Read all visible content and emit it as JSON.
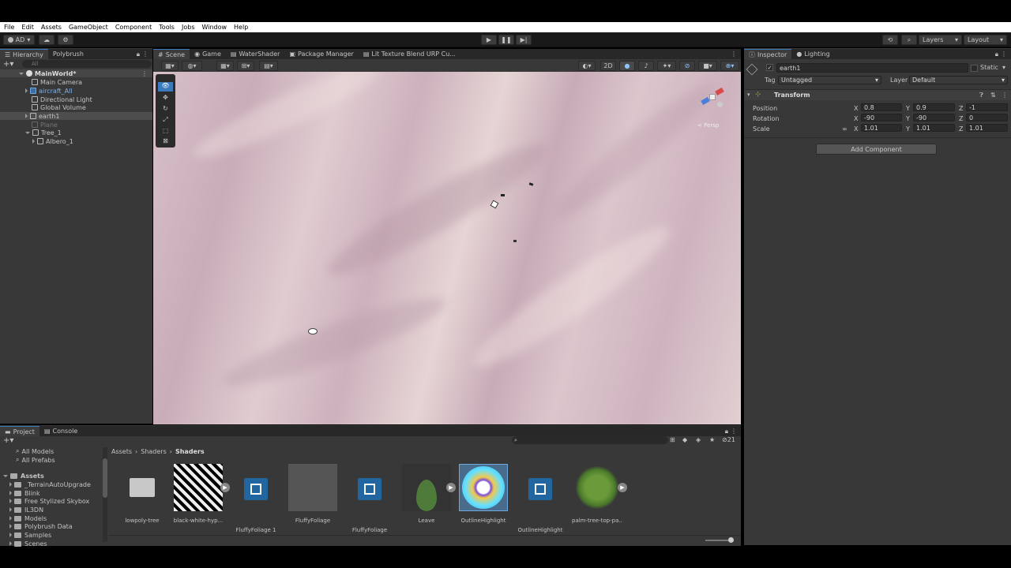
{
  "menu": [
    "File",
    "Edit",
    "Assets",
    "GameObject",
    "Component",
    "Tools",
    "Jobs",
    "Window",
    "Help"
  ],
  "toolbar": {
    "account": "AD",
    "layers": "Layers",
    "layout": "Layout"
  },
  "hierarchy": {
    "tabs": [
      "Hierarchy",
      "Polybrush"
    ],
    "search_placeholder": "All",
    "items": [
      {
        "label": "MainWorld*"
      },
      {
        "label": "Main Camera"
      },
      {
        "label": "aircraft_All"
      },
      {
        "label": "Directional Light"
      },
      {
        "label": "Global Volume"
      },
      {
        "label": "earth1"
      },
      {
        "label": "Plane"
      },
      {
        "label": "Tree_1"
      },
      {
        "label": "Albero_1"
      }
    ]
  },
  "scene_tabs": [
    "Scene",
    "Game",
    "WaterShader",
    "Package Manager",
    "Lit Texture Blend URP Cu..."
  ],
  "scene_toolbar": {
    "mode_2d": "2D"
  },
  "gizmo": {
    "persp": "< Persp"
  },
  "inspector": {
    "tabs": [
      "Inspector",
      "Lighting"
    ],
    "object_name": "earth1",
    "static_label": "Static",
    "tag_label": "Tag",
    "tag_value": "Untagged",
    "layer_label": "Layer",
    "layer_value": "Default",
    "component": "Transform",
    "position": {
      "label": "Position",
      "x": "0.8",
      "y": "0.9",
      "z": "-1"
    },
    "rotation": {
      "label": "Rotation",
      "x": "-90",
      "y": "-90",
      "z": "0"
    },
    "scale": {
      "label": "Scale",
      "x": "1.01",
      "y": "1.01",
      "z": "1.01"
    },
    "add_component": "Add Component"
  },
  "project": {
    "tabs": [
      "Project",
      "Console"
    ],
    "favorites": [
      "All Models",
      "All Prefabs"
    ],
    "assets_root": "Assets",
    "folders": [
      "_TerrainAutoUpgrade",
      "Blink",
      "Free Stylized Skybox",
      "IL3DN",
      "Models",
      "Polybrush Data",
      "Samples",
      "Scenes"
    ],
    "breadcrumb": [
      "Assets",
      "Shaders",
      "Shaders"
    ],
    "hidden_count": "21",
    "assets": [
      "lowpoly-tree",
      "black-white-hyp...",
      "FluffyFoliage 1",
      "FluffyFoliage",
      "FluffyFoliage",
      "Leave",
      "OutlineHighlight",
      "OutlineHighlight",
      "palm-tree-top-pa..."
    ]
  },
  "colors": {
    "accent": "#3a79bb",
    "scene_bg": "#d4bcc5",
    "panel": "#383838",
    "menubar": "#ffffff"
  }
}
